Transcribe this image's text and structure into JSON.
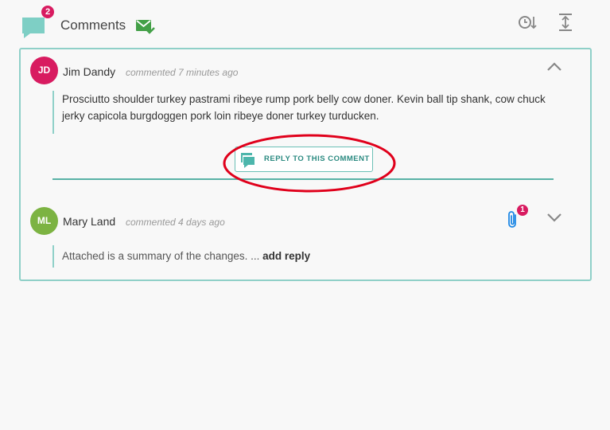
{
  "header": {
    "title": "Comments",
    "comment_count": "2",
    "icons": {
      "comments": "comment-bubble-icon",
      "mail": "mail-check-icon",
      "sort": "clock-sort-icon",
      "expand": "expand-vertical-icon"
    }
  },
  "colors": {
    "accent": "#4db6ac",
    "badge": "#d81b60",
    "avatar_jd": "#d81b60",
    "avatar_ml": "#7cb342",
    "highlight": "#e0001b"
  },
  "comments": [
    {
      "initials": "JD",
      "author": "Jim Dandy",
      "meta": "commented 7 minutes ago",
      "text": "Prosciutto shoulder turkey pastrami ribeye rump pork belly cow doner. Kevin ball tip shank, cow chuck jerky capicola burgdoggen pork loin ribeye doner turkey turducken.",
      "reply_label": "REPLY TO THIS COMMENT",
      "expanded": true
    },
    {
      "initials": "ML",
      "author": "Mary Land",
      "meta": "commented 4 days ago",
      "text": "Attached is a summary of the changes. ...",
      "add_reply_label": "add reply",
      "attachment_count": "1",
      "expanded": false
    }
  ]
}
